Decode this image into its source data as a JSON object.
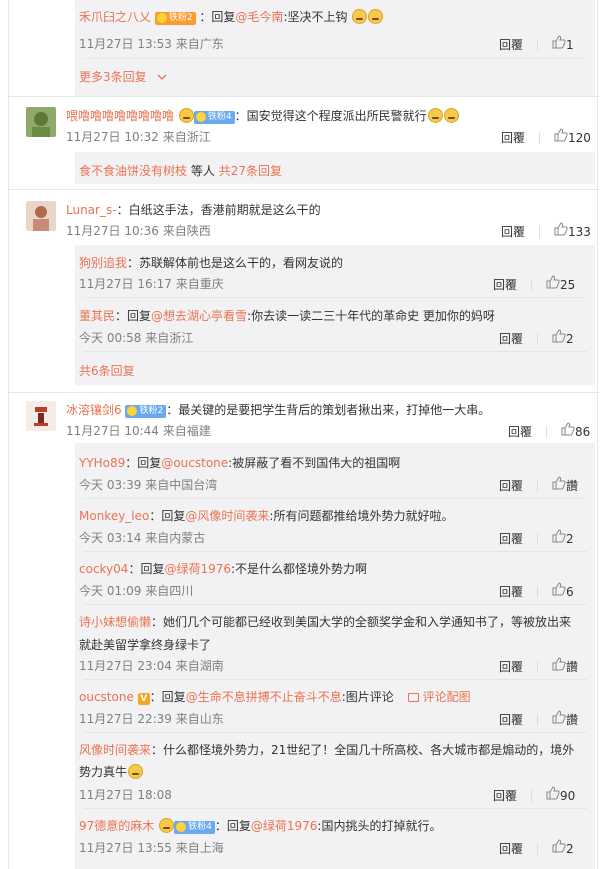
{
  "top_block": {
    "c1": {
      "nick": "禾爪臼之八乂",
      "badge": "铁粉2",
      "reply_word": "：回复",
      "at": "@毛今南",
      "text": ":坚决不上钩",
      "time": "11月27日 13:53 来自广东",
      "reply": "回覆",
      "likes": "1"
    },
    "more": "更多3条回复"
  },
  "comment_a": {
    "nick": "喂噜噜噜噜噜噜噜噜",
    "badge": "铁粉4",
    "text": "：国安觉得这个程度派出所民警就行",
    "time": "11月27日 10:32 来自浙江",
    "reply": "回覆",
    "likes": "120",
    "sub_nick": "食不食油饼没有树枝",
    "sub_text": "等人",
    "sub_more": "共27条回复"
  },
  "comment_b": {
    "nick": "Lunar_s-",
    "text": "：白纸这手法，香港前期就是这么干的",
    "time": "11月27日 10:36 来自陕西",
    "reply": "回覆",
    "likes": "133",
    "replies": [
      {
        "nick": "狗别追我",
        "text": "：苏联解体前也是这么干的，看网友说的",
        "time": "11月27日 16:17 来自重庆",
        "reply": "回覆",
        "likes": "25"
      },
      {
        "nick": "董其民",
        "reply_word": "：回复",
        "at": "@想去湖心亭看雪",
        "text": ":你去读一读二三十年代的革命史 更加你的妈呀",
        "time": "今天 00:58 来自浙江",
        "reply": "回覆",
        "likes": "2"
      }
    ],
    "more": "共6条回复"
  },
  "comment_c": {
    "nick": "冰溶镶剑6",
    "badge": "铁粉2",
    "text": "：最关键的是要把学生背后的策划者揪出来，打掉他一大串。",
    "time": "11月27日 10:44 来自福建",
    "reply": "回覆",
    "likes": "86",
    "replies": [
      {
        "nick": "YYHo89",
        "reply_word": "：回复",
        "at": "@oucstone",
        "text": ":被屏蔽了看不到国伟大的祖国啊",
        "time": "今天 03:39 来自中国台湾",
        "reply": "回覆",
        "likes": "讚"
      },
      {
        "nick": "Monkey_leo",
        "reply_word": "：回复",
        "at": "@风像时间袭来",
        "text": ":所有问题都推给境外势力就好啦。",
        "time": "今天 03:14 来自内蒙古",
        "reply": "回覆",
        "likes": "2"
      },
      {
        "nick": "cocky04",
        "reply_word": "：回复",
        "at": "@绿荷1976",
        "text": ":不是什么都怪境外势力啊",
        "time": "今天 01:09 来自四川",
        "reply": "回覆",
        "likes": "6"
      },
      {
        "nick": "诗小妹想偷懒",
        "text": "：她们几个可能都已经收到美国大学的全额奖学金和入学通知书了，等被放出来",
        "text2": "就赴美留学拿终身绿卡了",
        "time": "11月27日 23:04 来自湖南",
        "reply": "回覆",
        "likes": "讚"
      },
      {
        "nick": "oucstone",
        "reply_word": "：回复",
        "at": "@生命不息拼搏不止奋斗不息",
        "text": ":图片评论",
        "pic_link": "评论配图",
        "time": "11月27日 22:39 来自山东",
        "reply": "回覆",
        "likes": "讚"
      },
      {
        "nick": "风像时间袭来",
        "text": "：什么都怪境外势力，21世纪了！全国几十所高校、各大城市都是煽动的，境外",
        "text2": "势力真牛",
        "time": "11月27日 18:08",
        "reply": "回覆",
        "likes": "90"
      },
      {
        "nick": "97德意的麻木",
        "badge": "铁粉4",
        "reply_word": "：回复",
        "at": "@绿荷1976",
        "text": ":国内挑头的打掉就行。",
        "time": "11月27日 13:55 来自上海",
        "reply": "回覆",
        "likes": "2"
      }
    ]
  }
}
